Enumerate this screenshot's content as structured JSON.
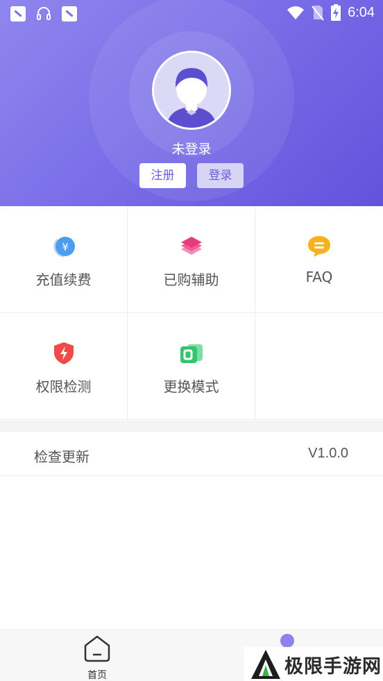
{
  "status_bar": {
    "time": "6:04",
    "icons": [
      "app-notification-icon",
      "headset-icon",
      "app-notification-icon",
      "wifi-icon",
      "no-sim-icon",
      "battery-charging-icon"
    ]
  },
  "profile": {
    "login_status": "未登录",
    "register_label": "注册",
    "login_label": "登录"
  },
  "menu": {
    "items": [
      {
        "label": "充值续费",
        "icon": "recharge-icon"
      },
      {
        "label": "已购辅助",
        "icon": "layers-icon"
      },
      {
        "label": "FAQ",
        "icon": "faq-chat-icon"
      },
      {
        "label": "权限检测",
        "icon": "shield-icon"
      },
      {
        "label": "更换模式",
        "icon": "switch-mode-icon"
      }
    ]
  },
  "update": {
    "label": "检查更新",
    "version": "V1.0.0"
  },
  "bottom_nav": {
    "home_label": "首页"
  },
  "watermark": {
    "text": "极限手游网"
  },
  "colors": {
    "header_gradient_start": "#8f86ee",
    "header_gradient_end": "#6253dc",
    "accent": "#6a5de0"
  }
}
